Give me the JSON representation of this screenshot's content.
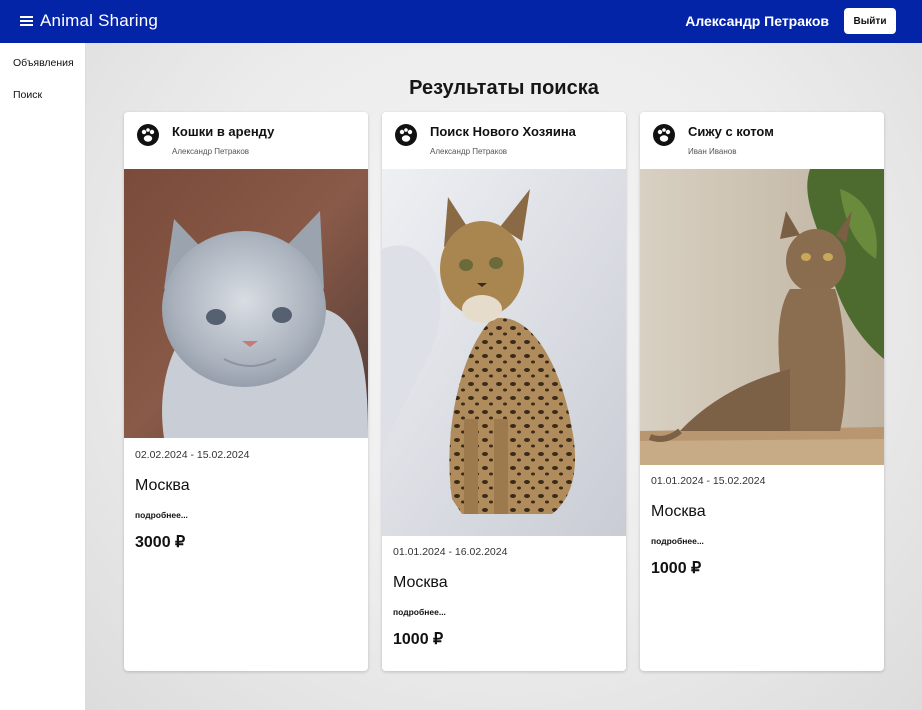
{
  "header": {
    "app_title": "Animal Sharing",
    "user_name": "Александр Петраков",
    "logout_label": "Выйти",
    "menu_icon": "hamburger-menu-icon",
    "accent": "#0424a8"
  },
  "sidebar": {
    "items": [
      {
        "label": "Объявления"
      },
      {
        "label": "Поиск"
      }
    ]
  },
  "main": {
    "title": "Результаты поиска",
    "cards": [
      {
        "title": "Кошки в аренду",
        "author": "Александр Петраков",
        "image": "grey-cat-photo",
        "dates": "02.02.2024 - 15.02.2024",
        "city": "Москва",
        "more": "подробнее...",
        "price": "3000 ₽"
      },
      {
        "title": "Поиск Нового Хозяина",
        "author": "Александр Петраков",
        "image": "savannah-cat-photo",
        "dates": "01.01.2024 - 16.02.2024",
        "city": "Москва",
        "more": "подробнее...",
        "price": "1000 ₽"
      },
      {
        "title": "Сижу с котом",
        "author": "Иван Иванов",
        "image": "abyssinian-cat-photo",
        "dates": "01.01.2024 - 15.02.2024",
        "city": "Москва",
        "more": "подробнее...",
        "price": "1000 ₽"
      }
    ]
  }
}
